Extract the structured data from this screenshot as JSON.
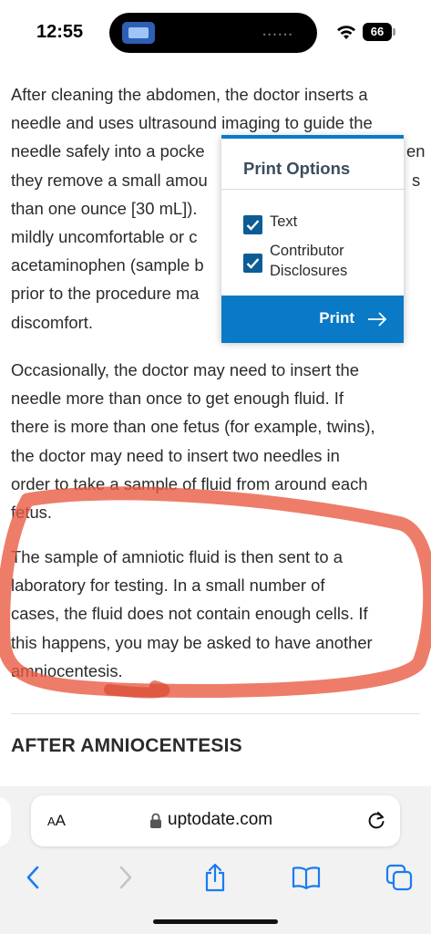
{
  "status_bar": {
    "time": "12:55",
    "battery": "66",
    "island_indicator": "••••••"
  },
  "article": {
    "paragraph1": [
      "After cleaning the abdomen, the doctor inserts a",
      "needle and uses ultrasound imaging to guide the",
      "needle safely into a pocke",
      "they remove a small amou",
      "than one ounce [30 mL]).",
      "mildly uncomfortable or c",
      "acetaminophen (sample b",
      "prior to the procedure ma",
      "discomfort."
    ],
    "paragraph1_peek": [
      "en",
      "s"
    ],
    "paragraph2": [
      "Occasionally, the doctor may need to insert the",
      "needle more than once to get enough fluid. If",
      "there is more than one fetus (for example, twins),",
      "the doctor may need to insert two needles in",
      "order to take a sample of fluid from around each",
      "fetus."
    ],
    "paragraph3": [
      "The sample of amniotic fluid is then sent to a",
      "laboratory for testing. In a small number of",
      "cases, the fluid does not contain enough cells. If",
      "this happens, you may be asked to have another",
      "amniocentesis."
    ],
    "section_heading": "AFTER AMNIOCENTESIS"
  },
  "print_options": {
    "title": "Print Options",
    "options": [
      {
        "label_lines": [
          "Text"
        ],
        "checked": true
      },
      {
        "label_lines": [
          "Contributor",
          "Disclosures"
        ],
        "checked": true
      }
    ],
    "button_label": "Print",
    "accent_color": "#0a7ac7"
  },
  "browser": {
    "text_size_label_small": "A",
    "text_size_label_large": "A",
    "url": "uptodate.com",
    "toolbar_icons": [
      "back-icon",
      "forward-icon",
      "share-icon",
      "bookmarks-icon",
      "tabs-icon"
    ],
    "tint_color": "#1a7cf0"
  },
  "annotation": {
    "marker_color": "#e8583f"
  }
}
